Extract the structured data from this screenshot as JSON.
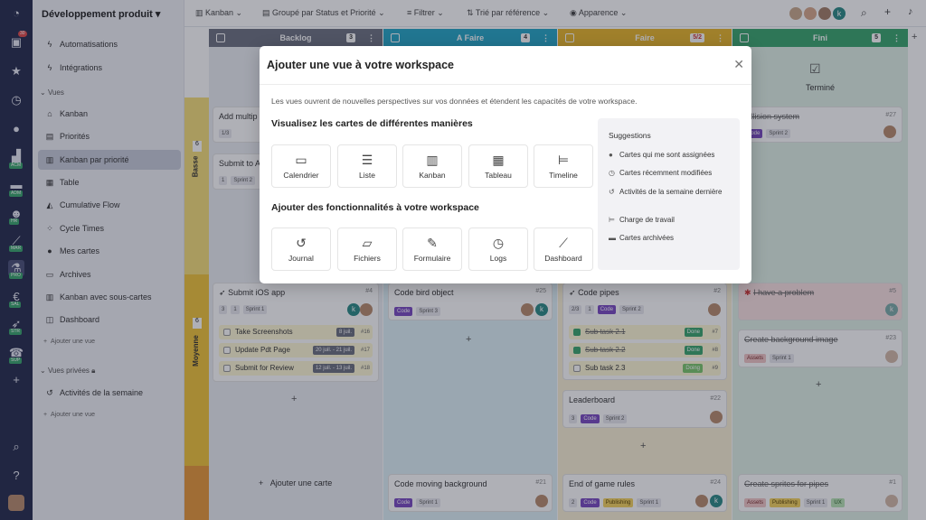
{
  "sidebar": {
    "workspace": "Développement produit",
    "items": [
      "Automatisations",
      "Intégrations"
    ],
    "section_vues": "Vues",
    "vues": [
      "Kanban",
      "Priorités",
      "Kanban par priorité",
      "Table",
      "Cumulative Flow",
      "Cycle Times",
      "Mes cartes",
      "Archives",
      "Kanban avec sous-cartes",
      "Dashboard"
    ],
    "add_vue": "Ajouter une vue",
    "section_privees": "Vues privées",
    "privees": [
      "Activités de la semaine"
    ],
    "add_vue2": "Ajouter une vue"
  },
  "rail": {
    "badge": "30",
    "labels": [
      "ACM",
      "ADM",
      "HR",
      "MAR",
      "PRO",
      "SAL",
      "STR",
      "SUP"
    ]
  },
  "topbar": {
    "view": "Kanban",
    "group": "Groupé par Status et Priorité",
    "filter": "Filtrer",
    "sort": "Trié par référence",
    "appearance": "Apparence",
    "avatar_k": "k"
  },
  "columns": [
    {
      "name": "Backlog",
      "count": "3",
      "color": "#6e7281"
    },
    {
      "name": "A Faire",
      "count": "4",
      "color": "#25a6c6"
    },
    {
      "name": "Faire",
      "count": "5/2",
      "color": "#e9b52a"
    },
    {
      "name": "Fini",
      "count": "5",
      "color": "#3aa76d"
    }
  ],
  "lanes": {
    "basse": "Basse",
    "basse_n": "6",
    "moyenne": "Moyenne",
    "moyenne_n": "6"
  },
  "board": {
    "done_label": "Terminé",
    "add_card": "Ajouter une carte",
    "c_addmul": "Add multip",
    "c_addmul_meta": "1/3",
    "c_submitA": "Submit to A",
    "c_submitA_meta": "1",
    "c_sprint2": "Sprint 2",
    "c_ios": "Submit iOS app",
    "c_ios_num": "#4",
    "c_ios_meta": "3",
    "c_ios_meta2": "1",
    "c_sprint1": "Sprint 1",
    "subs_ios": [
      {
        "t": "Take Screenshots",
        "d": "8 juil.",
        "n": "#16"
      },
      {
        "t": "Update Pdt Page",
        "d": "20 juil. - 21 juil.",
        "n": "#17"
      },
      {
        "t": "Submit for Review",
        "d": "12 juil. - 13 juil.",
        "n": "#18"
      }
    ],
    "c_bird": "Code bird object",
    "c_bird_num": "#25",
    "tag_code": "Code",
    "tag_sprint3": "Sprint 3",
    "c_pipes": "Code pipes",
    "c_pipes_num": "#2",
    "c_pipes_meta": "2/3",
    "c_pipes_meta2": "1",
    "subs_pipes": [
      {
        "t": "Sub task 2.1",
        "d": "Done",
        "n": "#7"
      },
      {
        "t": "Sub task 2.2",
        "d": "Done",
        "n": "#8"
      },
      {
        "t": "Sub task 2.3",
        "d": "Doing",
        "n": "#9"
      }
    ],
    "c_leader": "Leaderboard",
    "c_leader_num": "#22",
    "c_leader_meta": "3",
    "c_prob": "I have a problem",
    "c_prob_num": "#5",
    "c_bgimg": "Create background image",
    "c_bgimg_num": "#23",
    "tag_assets": "Assets",
    "c_collision": "...llision system",
    "c_collision_num": "#27",
    "c_moving": "Code moving background",
    "c_moving_num": "#21",
    "c_endrules": "End of game rules",
    "c_endrules_num": "#24",
    "c_endrules_meta": "2",
    "tag_pub": "Publishing",
    "c_sprites": "Create sprites for pipes",
    "c_sprites_num": "#1",
    "tag_ux": "UX"
  },
  "modal": {
    "title": "Ajouter une vue à votre workspace",
    "desc": "Les vues ouvrent de nouvelles perspectives sur vos données et étendent les capacités de votre workspace.",
    "h1": "Visualisez les cartes de différentes manières",
    "views": [
      "Calendrier",
      "Liste",
      "Kanban",
      "Tableau",
      "Timeline"
    ],
    "h2": "Ajouter des fonctionnalités à votre workspace",
    "features": [
      "Journal",
      "Fichiers",
      "Formulaire",
      "Logs",
      "Dashboard"
    ],
    "sugg_title": "Suggestions",
    "suggestions": [
      "Cartes qui me sont assignées",
      "Cartes récemment modifiées",
      "Activités de la semaine dernière",
      "Charge de travail",
      "Cartes archivées"
    ]
  }
}
